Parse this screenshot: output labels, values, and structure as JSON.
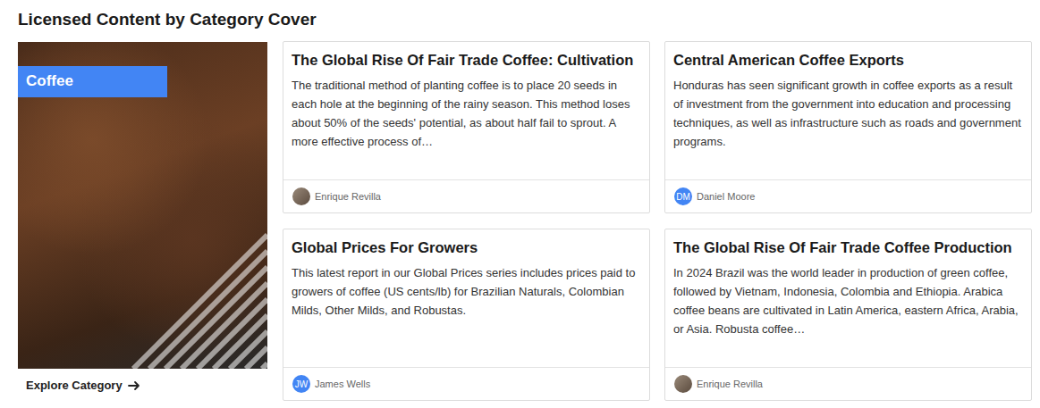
{
  "section": {
    "title": "Licensed Content by Category Cover"
  },
  "category": {
    "label": "Coffee",
    "link": "Explore Category"
  },
  "articles": [
    {
      "title": "The Global Rise Of Fair Trade Coffee: Cultivation",
      "body": "The traditional method of planting coffee is to place 20 seeds in each hole at the beginning of the rainy season. This method loses about 50% of the seeds' potential, as about half fail to sprout. A more effective process of…",
      "author": "Enrique Revilla",
      "avatar": {
        "kind": "photo",
        "initials": ""
      }
    },
    {
      "title": "Central American Coffee Exports",
      "body": "Honduras has seen significant growth in coffee exports as a result of investment from the government into education and processing techniques, as well as infrastructure such as roads and government programs.",
      "author": "Daniel Moore",
      "avatar": {
        "kind": "initials",
        "initials": "DM"
      }
    },
    {
      "title": "Global Prices For Growers",
      "body": "This latest report in our Global Prices series includes prices paid to growers of coffee (US cents/lb) for Brazilian Naturals, Colombian Milds, Other Milds, and Robustas.",
      "author": "James Wells",
      "avatar": {
        "kind": "initials",
        "initials": "JW"
      }
    },
    {
      "title": "The Global Rise Of Fair Trade Coffee Production",
      "body": "In 2024 Brazil was the world leader in production of green coffee, followed by Vietnam, Indonesia, Colombia and Ethiopia. Arabica coffee beans are cultivated in Latin America, eastern Africa, Arabia, or Asia. Robusta coffee…",
      "author": "Enrique Revilla",
      "avatar": {
        "kind": "photo",
        "initials": ""
      }
    }
  ]
}
